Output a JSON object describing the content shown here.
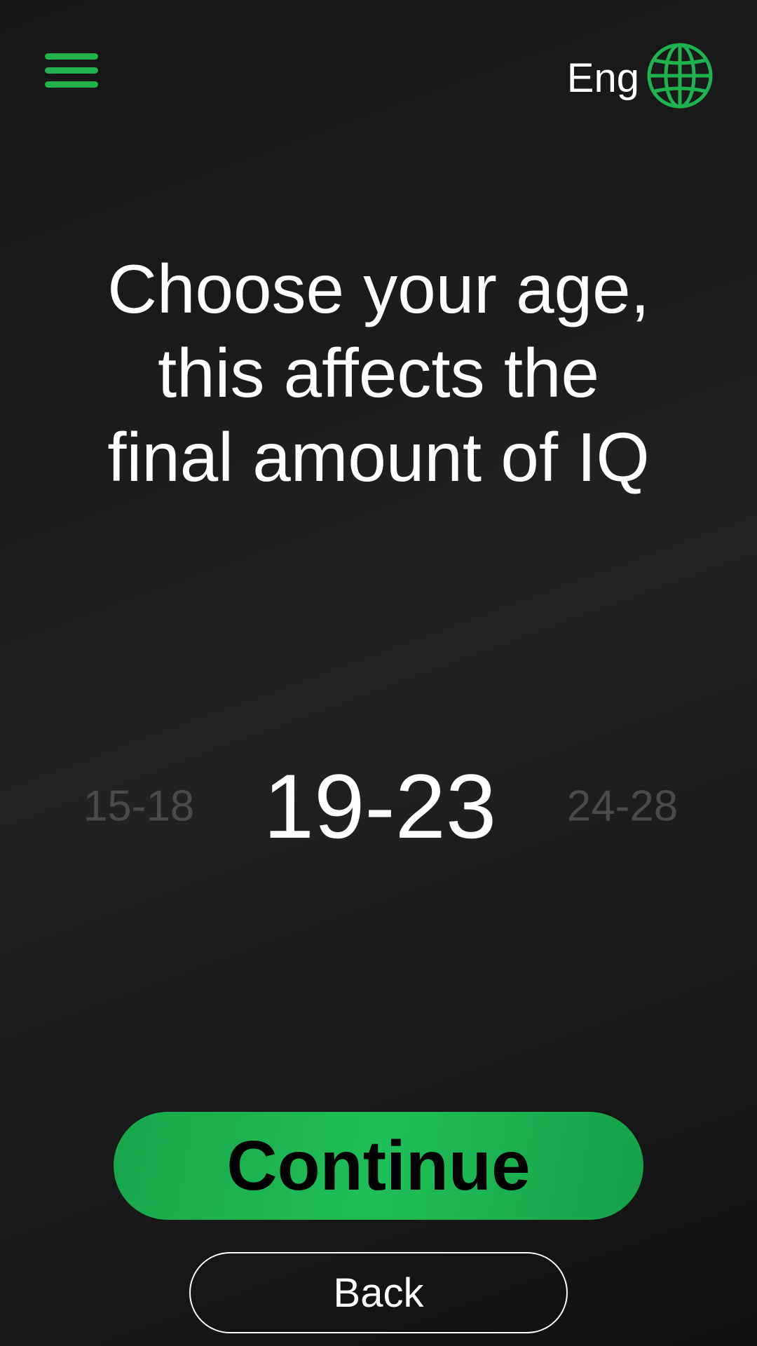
{
  "header": {
    "menu_icon": "hamburger-menu-icon",
    "language_label": "Eng",
    "language_icon": "globe-icon"
  },
  "title": {
    "lines": [
      "Choose your age,",
      "this affects the",
      "final amount of IQ"
    ]
  },
  "age_picker": {
    "previous": "15-18",
    "selected": "19-23",
    "next": "24-28"
  },
  "actions": {
    "continue_label": "Continue",
    "back_label": "Back"
  },
  "colors": {
    "accent": "#1fb24f",
    "background": "#1c1c1c",
    "text": "#ffffff",
    "muted_text": "#4a4a4a"
  }
}
